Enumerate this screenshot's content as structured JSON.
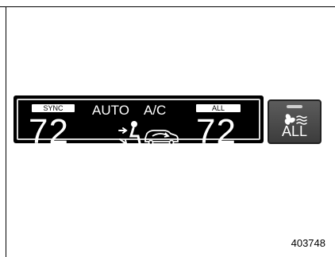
{
  "climate_display": {
    "sync_label": "SYNC",
    "auto_label": "AUTO",
    "ac_label": "A/C",
    "all_label": "ALL",
    "driver_temp": "72",
    "passenger_temp": "72",
    "airflow_mode_icon": "floor-and-face-airflow-icon",
    "recirc_icon": "car-recirculation-icon"
  },
  "fan_button": {
    "icon": "fan-speed-icon",
    "label": "ALL"
  },
  "figure_number": "403748",
  "colors": {
    "display_bg": "#000000",
    "display_text": "#ffffff",
    "button_bg": "#4a4a4a"
  }
}
